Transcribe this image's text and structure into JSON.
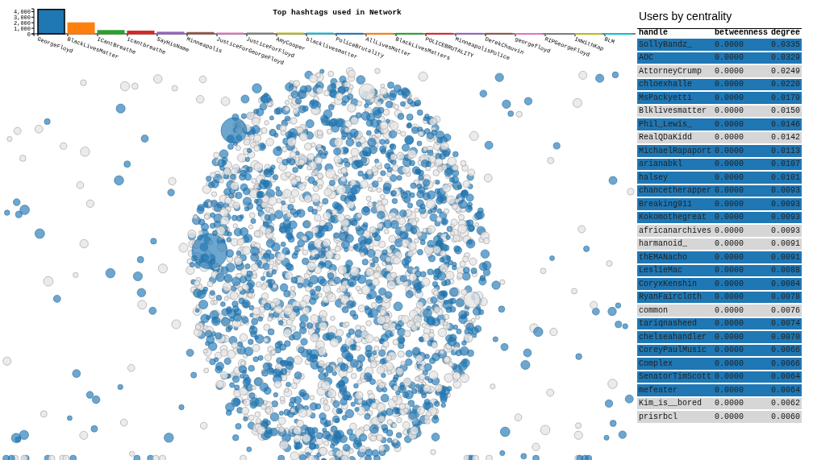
{
  "hashtag_chart": {
    "chart_data": {
      "type": "bar",
      "title": "Top hashtags used in Network",
      "categories": [
        "GeorgeFloyd",
        "BlackLivesMatter",
        "ICantBreathe",
        "icantbreathe",
        "SayHisName",
        "Minneapolis",
        "JusticeForGeorgeFloyd",
        "JusticeForFloyd",
        "AmyCooper",
        "blacklivesmatter",
        "PoliceBrutality",
        "AllLivesMatter",
        "BlackLivesMatters",
        "POLICEBRUTALITY",
        "MinneapolisPolice",
        "DerekChauvin",
        "georgefloyd",
        "RIPGeorgeFloyd",
        "ImWithKap",
        "BLM"
      ],
      "series": [
        {
          "values": [
            4400,
            2000,
            600,
            500,
            300,
            250,
            150,
            150,
            150,
            150,
            100,
            100,
            100,
            100,
            100,
            100,
            50,
            50,
            50,
            50
          ]
        }
      ],
      "colors": [
        "#1f77b4",
        "#ff7f0e",
        "#2ca02c",
        "#d62728",
        "#9467bd",
        "#8c564b",
        "#e377c2",
        "#7f7f7f",
        "#bcbd22",
        "#17becf",
        "#1f77b4",
        "#ff7f0e",
        "#2ca02c",
        "#d62728",
        "#9467bd",
        "#8c564b",
        "#e377c2",
        "#7f7f7f",
        "#bcbd22",
        "#17becf"
      ],
      "ylim": [
        0,
        4500
      ],
      "yticks": [
        {
          "value": 0,
          "label": "0"
        },
        {
          "value": 1000,
          "label": "1,000"
        },
        {
          "value": 2000,
          "label": "2,000"
        },
        {
          "value": 3000,
          "label": "3,000"
        },
        {
          "value": 4000,
          "label": "4,000"
        }
      ]
    }
  },
  "centrality": {
    "title": "Users by centrality",
    "columns": [
      "handle",
      "betweenness",
      "degree"
    ],
    "rows": [
      {
        "handle": "SollyBandz_",
        "betweenness": "0.0000",
        "degree": "0.0335",
        "highlighted": true
      },
      {
        "handle": "AOC",
        "betweenness": "0.0000",
        "degree": "0.0329",
        "highlighted": true
      },
      {
        "handle": "AttorneyCrump",
        "betweenness": "0.0000",
        "degree": "0.0249",
        "highlighted": false
      },
      {
        "handle": "chloexhalle",
        "betweenness": "0.0000",
        "degree": "0.0220",
        "highlighted": true
      },
      {
        "handle": "MsPackyetti",
        "betweenness": "0.0000",
        "degree": "0.0179",
        "highlighted": true
      },
      {
        "handle": "Blklivesmatter",
        "betweenness": "0.0000",
        "degree": "0.0150",
        "highlighted": false
      },
      {
        "handle": "Phil_Lewis_",
        "betweenness": "0.0000",
        "degree": "0.0146",
        "highlighted": true
      },
      {
        "handle": "RealQDaKidd",
        "betweenness": "0.0000",
        "degree": "0.0142",
        "highlighted": false
      },
      {
        "handle": "MichaelRapaport",
        "betweenness": "0.0000",
        "degree": "0.0113",
        "highlighted": true
      },
      {
        "handle": "arianabkl",
        "betweenness": "0.0000",
        "degree": "0.0107",
        "highlighted": true
      },
      {
        "handle": "halsey",
        "betweenness": "0.0000",
        "degree": "0.0101",
        "highlighted": true
      },
      {
        "handle": "chancetherapper",
        "betweenness": "0.0000",
        "degree": "0.0093",
        "highlighted": true
      },
      {
        "handle": "Breaking911",
        "betweenness": "0.0000",
        "degree": "0.0093",
        "highlighted": true
      },
      {
        "handle": "Kokomothegreat",
        "betweenness": "0.0000",
        "degree": "0.0093",
        "highlighted": true
      },
      {
        "handle": "africanarchives",
        "betweenness": "0.0000",
        "degree": "0.0093",
        "highlighted": false
      },
      {
        "handle": "harmanoid_",
        "betweenness": "0.0000",
        "degree": "0.0091",
        "highlighted": false
      },
      {
        "handle": "thEMANacho",
        "betweenness": "0.0000",
        "degree": "0.0091",
        "highlighted": true
      },
      {
        "handle": "LeslieMac",
        "betweenness": "0.0000",
        "degree": "0.0088",
        "highlighted": true
      },
      {
        "handle": "CoryxKenshin",
        "betweenness": "0.0000",
        "degree": "0.0084",
        "highlighted": true
      },
      {
        "handle": "RyanFaircloth",
        "betweenness": "0.0000",
        "degree": "0.0078",
        "highlighted": true
      },
      {
        "handle": "common",
        "betweenness": "0.0000",
        "degree": "0.0076",
        "highlighted": false
      },
      {
        "handle": "tariqnasheed",
        "betweenness": "0.0000",
        "degree": "0.0074",
        "highlighted": true
      },
      {
        "handle": "chelseahandler",
        "betweenness": "0.0000",
        "degree": "0.0070",
        "highlighted": true
      },
      {
        "handle": "CoreyPaulMusic",
        "betweenness": "0.0000",
        "degree": "0.0066",
        "highlighted": true
      },
      {
        "handle": "Complex",
        "betweenness": "0.0000",
        "degree": "0.0066",
        "highlighted": true
      },
      {
        "handle": "SenatorTimScott",
        "betweenness": "0.0000",
        "degree": "0.0064",
        "highlighted": true
      },
      {
        "handle": "mefeater",
        "betweenness": "0.0000",
        "degree": "0.0064",
        "highlighted": true
      },
      {
        "handle": "Kim_is__bored",
        "betweenness": "0.0000",
        "degree": "0.0062",
        "highlighted": false
      },
      {
        "handle": "prisrbcl",
        "betweenness": "0.0000",
        "degree": "0.0060",
        "highlighted": false
      }
    ]
  }
}
